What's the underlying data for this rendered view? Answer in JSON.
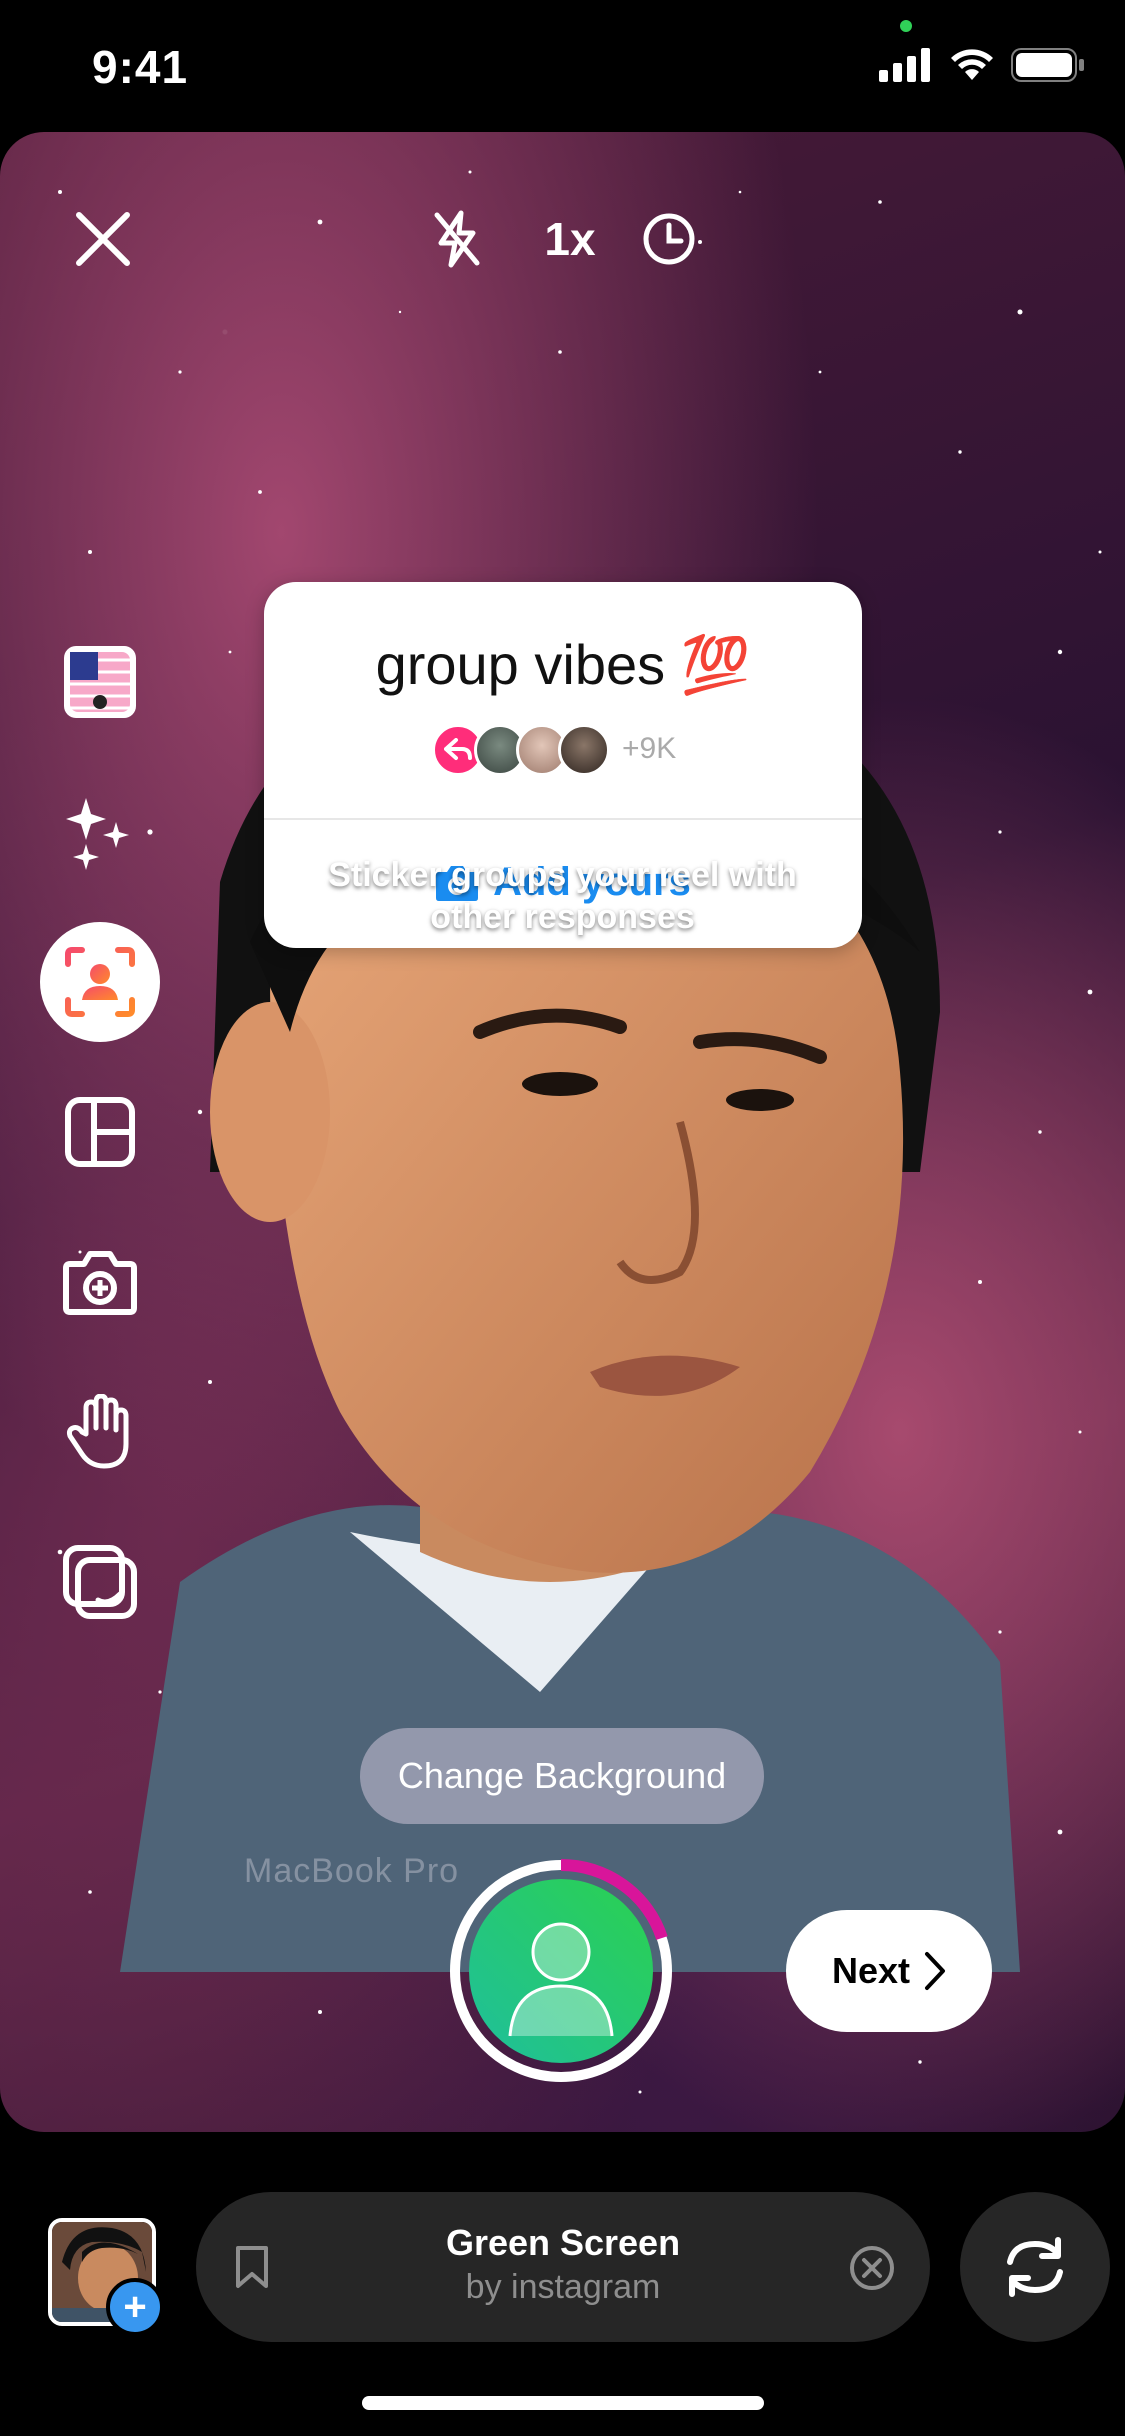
{
  "status_bar": {
    "time": "9:41"
  },
  "top_controls": {
    "close_icon": "close-icon",
    "flash_icon": "flash-off-icon",
    "speed_label": "1x",
    "timer_icon": "timer-icon"
  },
  "left_tools": [
    {
      "name": "music-flag-icon"
    },
    {
      "name": "effects-sparkle-icon"
    },
    {
      "name": "green-screen-icon",
      "active": true
    },
    {
      "name": "layout-icon"
    },
    {
      "name": "dual-camera-icon"
    },
    {
      "name": "hand-gesture-icon"
    },
    {
      "name": "align-icon"
    }
  ],
  "sticker": {
    "title": "group vibes 💯",
    "participant_count": "+9K",
    "add_label": "Add yours"
  },
  "hint_text_line1": "Sticker groups your reel with",
  "hint_text_line2": "other responses",
  "change_background_label": "Change Background",
  "background_text": "MacBook Pro",
  "next_label": "Next",
  "effect": {
    "name": "Green Screen",
    "author": "by instagram"
  },
  "colors": {
    "accent_blue": "#1a8cf0",
    "record_ring": "#d8159a",
    "reply_pink": "#ff2d7a"
  }
}
